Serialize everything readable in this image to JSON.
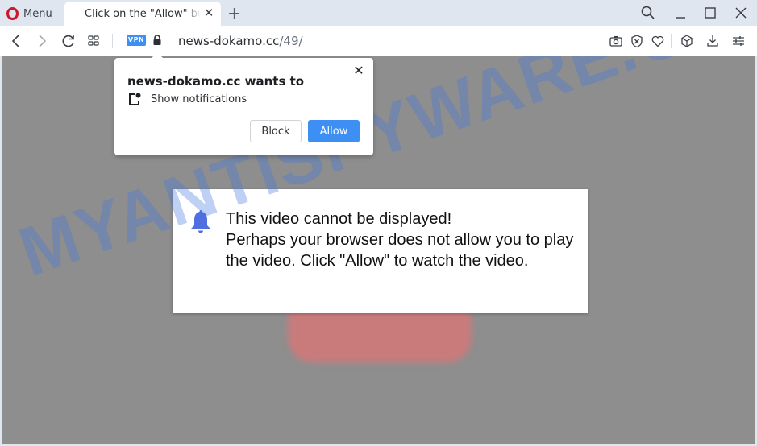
{
  "browser": {
    "menu_label": "Menu",
    "tab": {
      "title": "Click on the \"Allow\" button",
      "close_icon": "close-icon"
    },
    "new_tab_icon": "plus-icon",
    "window_controls": [
      "search-icon",
      "minimize-icon",
      "maximize-icon",
      "close-icon"
    ],
    "address_bar": {
      "vpn_label": "VPN",
      "url_domain": "news-dokamo.cc",
      "url_path": "/49/"
    },
    "toolbar_icons": [
      "camera-icon",
      "adblock-shield-icon",
      "heart-icon",
      "cube-icon",
      "download-icon",
      "settings-sliders-icon"
    ]
  },
  "permission_popup": {
    "title": "news-dokamo.cc wants to",
    "permission": "Show notifications",
    "block_label": "Block",
    "allow_label": "Allow",
    "close_label": "✕"
  },
  "message": {
    "line1": "This video cannot be displayed!",
    "line2": "Perhaps your browser does not allow you to play the video. Click \"Allow\" to watch the video.",
    "icon": "bell-icon",
    "icon_color": "#4f6fe0"
  },
  "watermark": "MYANTISPYWARE.COM",
  "colors": {
    "accent": "#3d8ff4",
    "overlay": "#8e8e8e",
    "opera_red": "#d3142a"
  }
}
